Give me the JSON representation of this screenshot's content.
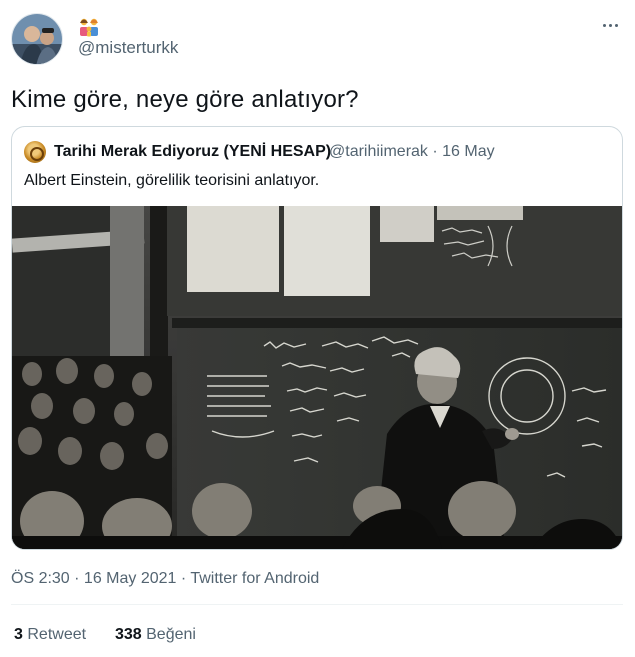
{
  "author": {
    "handle": "@misterturkk",
    "display_name_icon": "family-emoji"
  },
  "tweet": {
    "text": "Kime göre, neye göre anlatıyor?"
  },
  "quoted": {
    "name": "Tarihi Merak Ediyoruz (YENİ HESAP)",
    "handle_date": "@tarihiimerak · 16 May",
    "text": "Albert Einstein, görelilik teorisini anlatıyor.",
    "image_icon": "einstein-lecture-photo"
  },
  "meta": {
    "timestamp_source": "ÖS 2:30 · 16 May 2021 · Twitter for Android"
  },
  "stats": {
    "retweet_count": "3",
    "retweet_label": "Retweet",
    "like_count": "338",
    "like_label": "Beğeni"
  },
  "icons": {
    "more": "more-horizontal-icon"
  },
  "colors": {
    "text_primary": "#0f1419",
    "text_secondary": "#536471",
    "border": "#cfd9de"
  }
}
